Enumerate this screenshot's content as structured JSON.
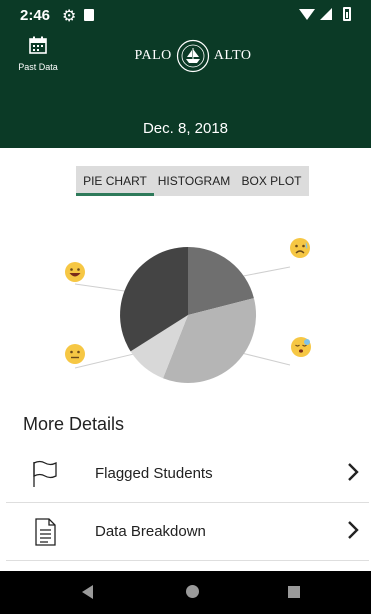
{
  "status_bar": {
    "time": "2:46"
  },
  "header": {
    "past_data_label": "Past Data",
    "logo_left": "PALO",
    "logo_right": "ALTO",
    "date": "Dec. 8, 2018"
  },
  "tabs": [
    {
      "label": "PIE CHART",
      "selected": true
    },
    {
      "label": "HISTOGRAM",
      "selected": false
    },
    {
      "label": "BOX PLOT",
      "selected": false
    }
  ],
  "chart_data": {
    "type": "pie",
    "slices": [
      {
        "label": "",
        "emoji": "worried-face-icon",
        "value": 21,
        "color": "#6f6f6f"
      },
      {
        "label": "",
        "emoji": "sleepy-face-icon",
        "value": 35,
        "color": "#b5b5b5"
      },
      {
        "label": "",
        "emoji": "neutral-face-icon",
        "value": 10,
        "color": "#d8d8d8"
      },
      {
        "label": "",
        "emoji": "grinning-face-icon",
        "value": 34,
        "color": "#444444"
      }
    ]
  },
  "more_details": {
    "title": "More Details",
    "items": [
      {
        "label": "Flagged Students",
        "icon": "flag-icon"
      },
      {
        "label": "Data Breakdown",
        "icon": "document-icon"
      }
    ]
  }
}
